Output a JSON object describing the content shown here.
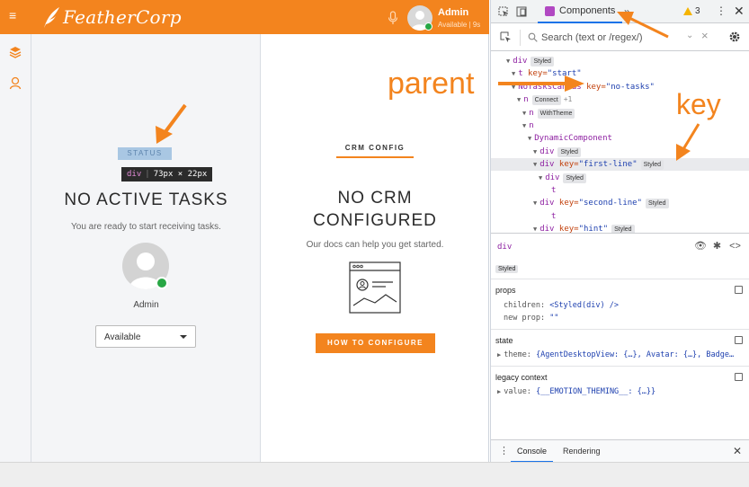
{
  "app": {
    "brand": "FeatherCorp",
    "user_name": "Admin",
    "user_status": "Available | 9s",
    "status_label": "STATUS",
    "inspect_tag": "div",
    "inspect_size": "73px × 22px",
    "no_tasks_title": "NO ACTIVE TASKS",
    "no_tasks_sub": "You are ready to start receiving tasks.",
    "avatar_name": "Admin",
    "availability_value": "Available",
    "crm_label": "CRM CONFIG",
    "crm_title_line1": "NO CRM",
    "crm_title_line2": "CONFIGURED",
    "crm_sub": "Our docs can help you get started.",
    "configure_button": "HOW TO CONFIGURE",
    "accent_color": "#f3841e"
  },
  "devtools": {
    "tab_components": "Components",
    "more_tabs": "»",
    "warnings_count": "3",
    "search_placeholder": "Search (text or /regex/)",
    "tree": [
      {
        "indent": 0,
        "name": "div",
        "badge": "Styled"
      },
      {
        "indent": 1,
        "name": "t",
        "key": "start"
      },
      {
        "indent": 1,
        "name": "NoTasksCanvas",
        "key": "no-tasks"
      },
      {
        "indent": 2,
        "name": "n",
        "badge": "Connect",
        "extra": "+1"
      },
      {
        "indent": 3,
        "name": "n",
        "badge": "WithTheme"
      },
      {
        "indent": 3,
        "name": "n"
      },
      {
        "indent": 4,
        "name": "DynamicComponent"
      },
      {
        "indent": 5,
        "name": "div",
        "badge": "Styled"
      },
      {
        "indent": 5,
        "name": "div",
        "key": "first-line",
        "badge": "Styled",
        "selected": true
      },
      {
        "indent": 6,
        "name": "div",
        "badge": "Styled"
      },
      {
        "indent": 7,
        "name": "t",
        "leaf": true
      },
      {
        "indent": 5,
        "name": "div",
        "key": "second-line",
        "badge": "Styled"
      },
      {
        "indent": 7,
        "name": "t",
        "leaf": true
      },
      {
        "indent": 5,
        "name": "div",
        "key": "hint",
        "badge": "Styled"
      }
    ],
    "detail_title": "div",
    "detail_badge": "Styled",
    "props_title": "props",
    "prop_children_key": "children:",
    "prop_children_val": "<Styled(div) />",
    "prop_new_key": "new prop:",
    "prop_new_val": "\"\"",
    "state_title": "state",
    "state_theme_key": "theme:",
    "state_theme_val": "{AgentDesktopView: {…}, Avatar: {…}, Badge…",
    "legacy_title": "legacy context",
    "legacy_value_key": "value:",
    "legacy_value_val": "{__EMOTION_THEMING__: {…}}",
    "drawer_console": "Console",
    "drawer_rendering": "Rendering"
  },
  "annotations": {
    "parent": "parent",
    "key": "key"
  }
}
